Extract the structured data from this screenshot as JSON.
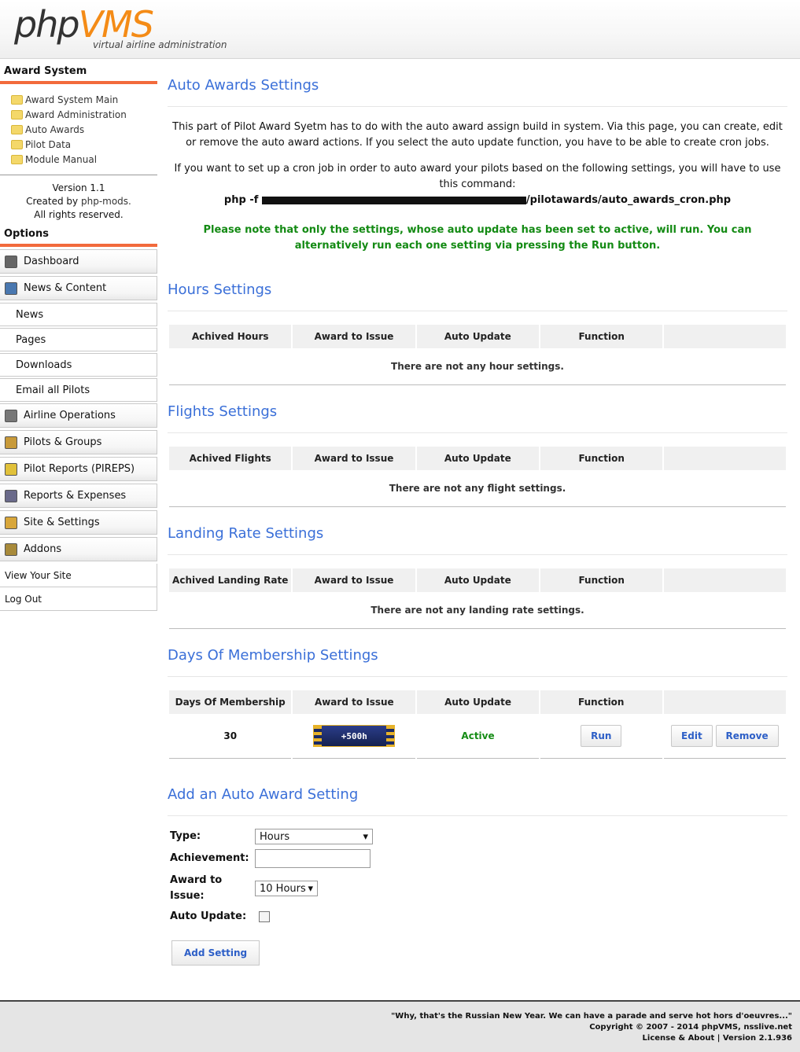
{
  "header": {
    "logo_php": "php",
    "logo_vms": "VMS",
    "tagline": "virtual airline administration"
  },
  "sidebar": {
    "award_title": "Award System",
    "award_links": [
      "Award System Main",
      "Award Administration",
      "Auto Awards",
      "Pilot Data",
      "Module Manual"
    ],
    "version": "Version 1.1",
    "created_by_prefix": "Created by",
    "created_by_link": "php-mods.",
    "rights": "All rights reserved.",
    "options_title": "Options",
    "menu": [
      {
        "label": "Dashboard"
      },
      {
        "label": "News & Content"
      },
      {
        "label": "News"
      },
      {
        "label": "Pages"
      },
      {
        "label": "Downloads"
      },
      {
        "label": "Email all Pilots"
      },
      {
        "label": "Airline Operations"
      },
      {
        "label": "Pilots & Groups"
      },
      {
        "label": "Pilot Reports (PIREPS)"
      },
      {
        "label": "Reports & Expenses"
      },
      {
        "label": "Site & Settings"
      },
      {
        "label": "Addons"
      },
      {
        "label": "View Your Site"
      },
      {
        "label": "Log Out"
      }
    ]
  },
  "main": {
    "title": "Auto Awards Settings",
    "intro1": "This part of Pilot Award Syetm has to do with the auto award assign build in system. Via this page, you can create, edit or remove the auto award actions. If you select the auto update function, you have to be able to create cron jobs.",
    "intro2": "If you want to set up a cron job in order to auto award your pilots based on the following settings, you will have to use this command:",
    "cmd_prefix": "php -f ",
    "cmd_suffix": "/pilotawards/auto_awards_cron.php",
    "note": "Please note that only the settings, whose auto update has been set to active, will run. You can alternatively run each one setting via pressing the Run button.",
    "hours": {
      "title": "Hours Settings",
      "headers": [
        "Achived Hours",
        "Award to Issue",
        "Auto Update",
        "Function",
        ""
      ],
      "empty": "There are not any hour settings."
    },
    "flights": {
      "title": "Flights Settings",
      "headers": [
        "Achived Flights",
        "Award to Issue",
        "Auto Update",
        "Function",
        ""
      ],
      "empty": "There are not any flight settings."
    },
    "landing": {
      "title": "Landing Rate Settings",
      "headers": [
        "Achived Landing Rate",
        "Award to Issue",
        "Auto Update",
        "Function",
        ""
      ],
      "empty": "There are not any landing rate settings."
    },
    "days": {
      "title": "Days Of Membership Settings",
      "headers": [
        "Days Of Membership",
        "Award to Issue",
        "Auto Update",
        "Function",
        ""
      ],
      "row": {
        "days": "30",
        "award": "+500h",
        "status": "Active",
        "run": "Run",
        "edit": "Edit",
        "remove": "Remove"
      }
    },
    "add": {
      "title": "Add an Auto Award Setting",
      "type_label": "Type:",
      "type_value": "Hours",
      "achievement_label": "Achievement:",
      "achievement_value": "",
      "award_label": "Award to Issue:",
      "award_value": "10 Hours",
      "auto_label": "Auto Update:",
      "auto_checked": false,
      "button": "Add Setting"
    }
  },
  "footer": {
    "quote": "\"Why, that's the Russian New Year. We can have a parade and serve hot hors d'oeuvres...\"",
    "copyright": "Copyright © 2007 - 2014 phpVMS, nsslive.net",
    "license": "License & About | Version 2.1.936"
  },
  "colors": {
    "accent": "#3a6fd8",
    "orange": "#f48b16",
    "green": "#138a13"
  }
}
